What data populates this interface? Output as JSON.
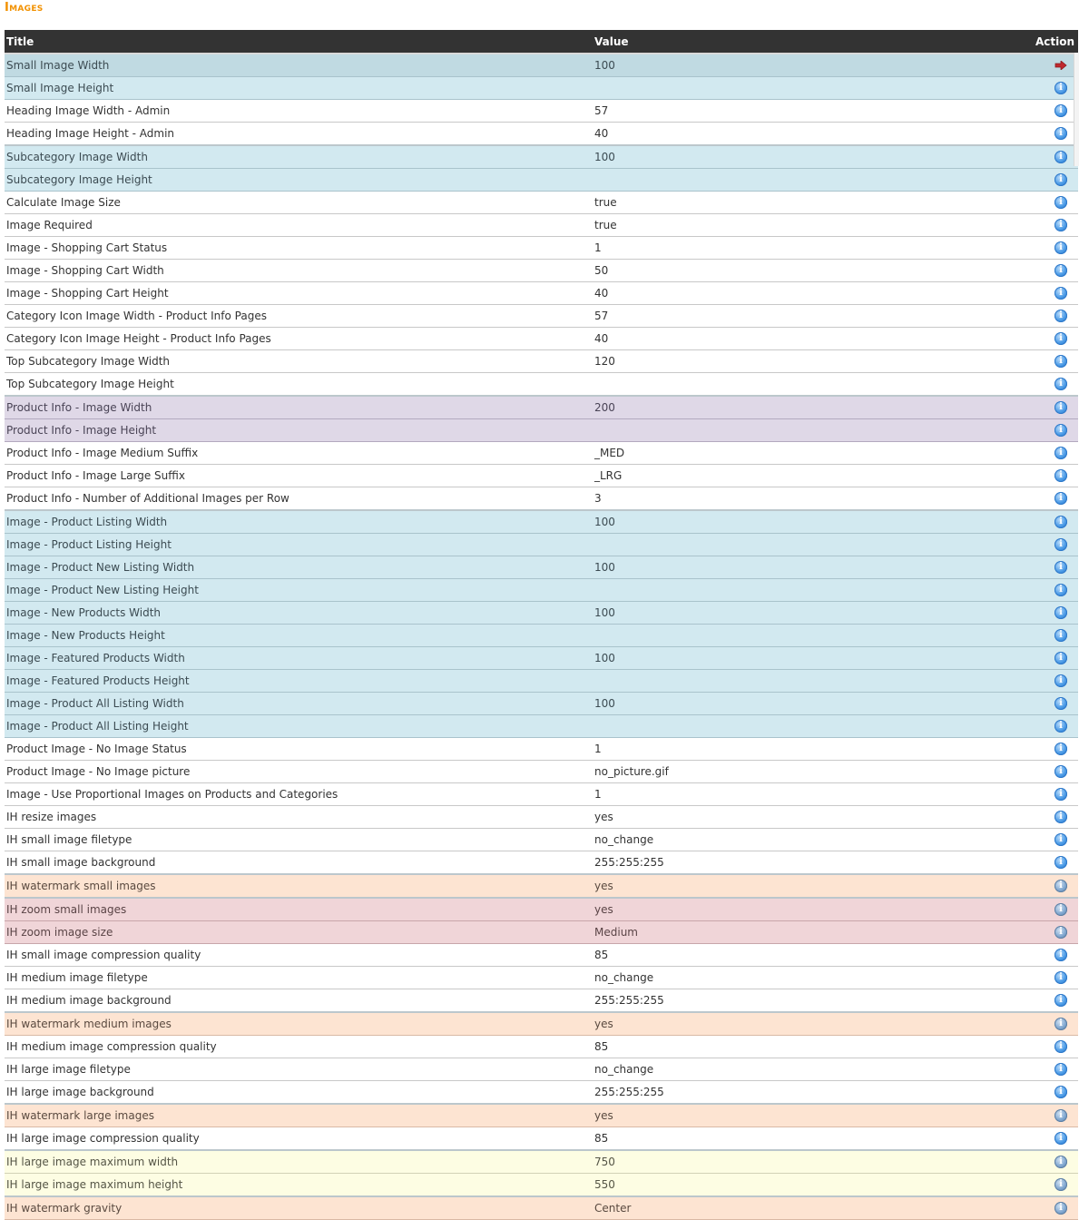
{
  "page": {
    "title": "Images"
  },
  "table": {
    "headers": {
      "title": "Title",
      "value": "Value",
      "action": "Action"
    },
    "rows": [
      {
        "title": "Small Image Width",
        "value": "100",
        "style": "blue-sel",
        "action_icon": "arrow-right-icon"
      },
      {
        "title": "Small Image Height",
        "value": "",
        "style": "blue",
        "action_icon": "info-icon"
      },
      {
        "title": "Heading Image Width - Admin",
        "value": "57",
        "style": "",
        "action_icon": "info-icon"
      },
      {
        "title": "Heading Image Height - Admin",
        "value": "40",
        "style": "",
        "action_icon": "info-icon"
      },
      {
        "title": "Subcategory Image Width",
        "value": "100",
        "style": "blue",
        "action_icon": "info-icon"
      },
      {
        "title": "Subcategory Image Height",
        "value": "",
        "style": "blue",
        "action_icon": "info-icon"
      },
      {
        "title": "Calculate Image Size",
        "value": "true",
        "style": "",
        "action_icon": "info-icon"
      },
      {
        "title": "Image Required",
        "value": "true",
        "style": "",
        "action_icon": "info-icon"
      },
      {
        "title": "Image - Shopping Cart Status",
        "value": "1",
        "style": "",
        "action_icon": "info-icon"
      },
      {
        "title": "Image - Shopping Cart Width",
        "value": "50",
        "style": "",
        "action_icon": "info-icon"
      },
      {
        "title": "Image - Shopping Cart Height",
        "value": "40",
        "style": "",
        "action_icon": "info-icon"
      },
      {
        "title": "Category Icon Image Width - Product Info Pages",
        "value": "57",
        "style": "",
        "action_icon": "info-icon"
      },
      {
        "title": "Category Icon Image Height - Product Info Pages",
        "value": "40",
        "style": "",
        "action_icon": "info-icon"
      },
      {
        "title": "Top Subcategory Image Width",
        "value": "120",
        "style": "",
        "action_icon": "info-icon"
      },
      {
        "title": "Top Subcategory Image Height",
        "value": "",
        "style": "",
        "action_icon": "info-icon"
      },
      {
        "title": "Product Info - Image Width",
        "value": "200",
        "style": "purple",
        "action_icon": "info-icon"
      },
      {
        "title": "Product Info - Image Height",
        "value": "",
        "style": "purple",
        "action_icon": "info-icon"
      },
      {
        "title": "Product Info - Image Medium Suffix",
        "value": "_MED",
        "style": "",
        "action_icon": "info-icon"
      },
      {
        "title": "Product Info - Image Large Suffix",
        "value": "_LRG",
        "style": "",
        "action_icon": "info-icon"
      },
      {
        "title": "Product Info - Number of Additional Images per Row",
        "value": "3",
        "style": "",
        "action_icon": "info-icon"
      },
      {
        "title": "Image - Product Listing Width",
        "value": "100",
        "style": "blue",
        "action_icon": "info-icon"
      },
      {
        "title": "Image - Product Listing Height",
        "value": "",
        "style": "blue",
        "action_icon": "info-icon"
      },
      {
        "title": "Image - Product New Listing Width",
        "value": "100",
        "style": "blue",
        "action_icon": "info-icon"
      },
      {
        "title": "Image - Product New Listing Height",
        "value": "",
        "style": "blue",
        "action_icon": "info-icon"
      },
      {
        "title": "Image - New Products Width",
        "value": "100",
        "style": "blue",
        "action_icon": "info-icon"
      },
      {
        "title": "Image - New Products Height",
        "value": "",
        "style": "blue",
        "action_icon": "info-icon"
      },
      {
        "title": "Image - Featured Products Width",
        "value": "100",
        "style": "blue",
        "action_icon": "info-icon"
      },
      {
        "title": "Image - Featured Products Height",
        "value": "",
        "style": "blue",
        "action_icon": "info-icon"
      },
      {
        "title": "Image - Product All Listing Width",
        "value": "100",
        "style": "blue",
        "action_icon": "info-icon"
      },
      {
        "title": "Image - Product All Listing Height",
        "value": "",
        "style": "blue",
        "action_icon": "info-icon"
      },
      {
        "title": "Product Image - No Image Status",
        "value": "1",
        "style": "",
        "action_icon": "info-icon"
      },
      {
        "title": "Product Image - No Image picture",
        "value": "no_picture.gif",
        "style": "",
        "action_icon": "info-icon"
      },
      {
        "title": "Image - Use Proportional Images on Products and Categories",
        "value": "1",
        "style": "",
        "action_icon": "info-icon"
      },
      {
        "title": "IH resize images",
        "value": "yes",
        "style": "",
        "action_icon": "info-icon"
      },
      {
        "title": "IH small image filetype",
        "value": "no_change",
        "style": "",
        "action_icon": "info-icon"
      },
      {
        "title": "IH small image background",
        "value": "255:255:255",
        "style": "",
        "action_icon": "info-icon"
      },
      {
        "title": "IH watermark small images",
        "value": "yes",
        "style": "peach",
        "action_icon": "info-icon"
      },
      {
        "title": "IH zoom small images",
        "value": "yes",
        "style": "pink",
        "action_icon": "info-icon"
      },
      {
        "title": "IH zoom image size",
        "value": "Medium",
        "style": "pink",
        "action_icon": "info-icon"
      },
      {
        "title": "IH small image compression quality",
        "value": "85",
        "style": "",
        "action_icon": "info-icon"
      },
      {
        "title": "IH medium image filetype",
        "value": "no_change",
        "style": "",
        "action_icon": "info-icon"
      },
      {
        "title": "IH medium image background",
        "value": "255:255:255",
        "style": "",
        "action_icon": "info-icon"
      },
      {
        "title": "IH watermark medium images",
        "value": "yes",
        "style": "peach",
        "action_icon": "info-icon"
      },
      {
        "title": "IH medium image compression quality",
        "value": "85",
        "style": "",
        "action_icon": "info-icon"
      },
      {
        "title": "IH large image filetype",
        "value": "no_change",
        "style": "",
        "action_icon": "info-icon"
      },
      {
        "title": "IH large image background",
        "value": "255:255:255",
        "style": "",
        "action_icon": "info-icon"
      },
      {
        "title": "IH watermark large images",
        "value": "yes",
        "style": "peach",
        "action_icon": "info-icon"
      },
      {
        "title": "IH large image compression quality",
        "value": "85",
        "style": "",
        "action_icon": "info-icon"
      },
      {
        "title": "IH large image maximum width",
        "value": "750",
        "style": "yellow",
        "action_icon": "info-icon"
      },
      {
        "title": "IH large image maximum height",
        "value": "550",
        "style": "yellow",
        "action_icon": "info-icon"
      },
      {
        "title": "IH watermark gravity",
        "value": "Center",
        "style": "peach",
        "action_icon": "info-icon"
      }
    ]
  },
  "colors": {
    "title_accent": "#f29100",
    "header_bg": "#333333",
    "row_blue": "#d2e9f0",
    "row_blue_selected": "#c0dae2",
    "row_purple": "#dfd8e7",
    "row_peach": "#fde4d2",
    "row_pink": "#f0d5d8",
    "row_yellow": "#fdfde3",
    "arrow_red": "#c0282d"
  }
}
